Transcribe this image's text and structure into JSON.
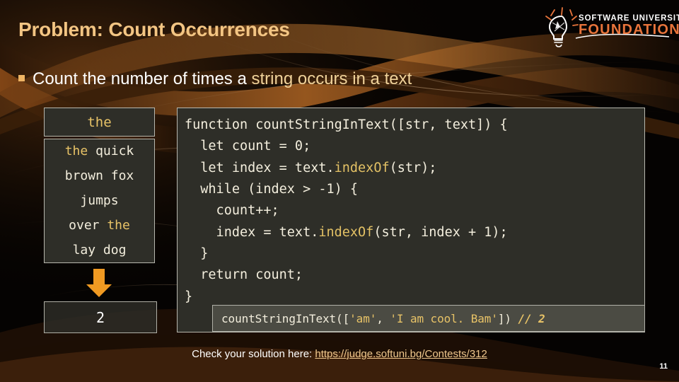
{
  "slide": {
    "title": "Problem: Count Occurrences",
    "page_number": "11"
  },
  "logo": {
    "icon": "lightbulb-icon",
    "line1": "SOFTWARE UNIVERSITY",
    "line2": "FOUNDATION",
    "line1_color": "#ffffff",
    "line2_color": "#e8743b"
  },
  "bullet": {
    "marker": "square-bullet",
    "text_plain": "Count the number of times a ",
    "text_highlight": "string occurs in a text"
  },
  "example": {
    "input_header": "the",
    "input_lines": [
      {
        "pre": "",
        "hl": "the",
        "post": " quick"
      },
      {
        "pre": "brown fox",
        "hl": "",
        "post": ""
      },
      {
        "pre": "jumps",
        "hl": "",
        "post": ""
      },
      {
        "pre": "over ",
        "hl": "the",
        "post": ""
      },
      {
        "pre": "lay dog",
        "hl": "",
        "post": ""
      }
    ],
    "arrow": "down-arrow-icon",
    "result": "2"
  },
  "code": {
    "lines": [
      {
        "text": "function countStringInText([str, text]) {"
      },
      {
        "text": "  let count = 0;"
      },
      {
        "pre": "  let index = text.",
        "fn": "indexOf",
        "post": "(str);"
      },
      {
        "text": "  while (index > -1) {"
      },
      {
        "text": "    count++;"
      },
      {
        "pre": "    index = text.",
        "fn": "indexOf",
        "post": "(str, index + 1);"
      },
      {
        "text": "  }"
      },
      {
        "text": "  return count;"
      },
      {
        "text": "}"
      }
    ]
  },
  "call_example": {
    "prefix": "countStringInText([",
    "arg1": "'am'",
    "separator": ", ",
    "arg2": "'I am cool. Bam'",
    "suffix": "]) ",
    "comment": "// 2"
  },
  "footer": {
    "label": "Check your solution here: ",
    "link": "https://judge.softuni.bg/Contests/312"
  },
  "colors": {
    "accent_gold": "#e8c367",
    "title_gold": "#f3c583",
    "orange": "#e8743b",
    "code_bg": "#2e2e28",
    "box_border": "#b7b7ae"
  }
}
